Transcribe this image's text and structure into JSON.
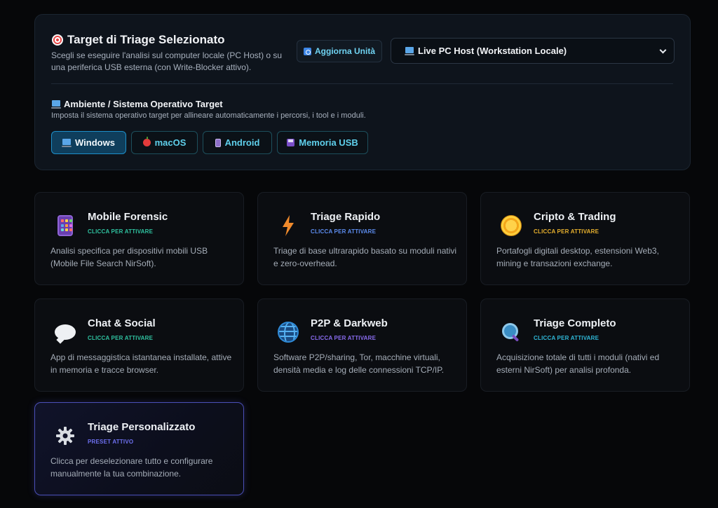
{
  "target_panel": {
    "title": "Target di Triage Selezionato",
    "description": "Scegli se eseguire l'analisi sul computer locale (PC Host) o su una periferica USB esterna (con Write-Blocker attivo).",
    "refresh_label": "Aggiorna Unità",
    "selected_target": "Live PC Host (Workstation Locale)"
  },
  "environment": {
    "title": "Ambiente / Sistema Operativo Target",
    "description": "Imposta il sistema operativo target per allineare automaticamente i percorsi, i tool e i moduli.",
    "options": [
      {
        "label": "Windows",
        "icon": "pc-icon",
        "active": true
      },
      {
        "label": "macOS",
        "icon": "apple-icon",
        "active": false
      },
      {
        "label": "Android",
        "icon": "phone-icon",
        "active": false
      },
      {
        "label": "Memoria USB",
        "icon": "floppy-disk-icon",
        "active": false
      }
    ]
  },
  "presets": [
    {
      "title": "Mobile Forensic",
      "status": "CLICCA PER ATTIVARE",
      "status_color": "#2fc2a0",
      "description": "Analisi specifica per dispositivi mobili USB (Mobile File Search NirSoft).",
      "icon": "mobile-phone-icon"
    },
    {
      "title": "Triage Rapido",
      "status": "CLICCA PER ATTIVARE",
      "status_color": "#5d8df0",
      "description": "Triage di base ultrarapido basato su moduli nativi e zero-overhead.",
      "icon": "lightning-bolt-icon"
    },
    {
      "title": "Cripto & Trading",
      "status": "CLICCA PER ATTIVARE",
      "status_color": "#e8b12e",
      "description": "Portafogli digitali desktop, estensioni Web3, mining e transazioni exchange.",
      "icon": "coin-icon"
    },
    {
      "title": "Chat & Social",
      "status": "CLICCA PER ATTIVARE",
      "status_color": "#2fc2a0",
      "description": "App di messaggistica istantanea installate, attive in memoria e tracce browser.",
      "icon": "chat-bubble-icon"
    },
    {
      "title": "P2P & Darkweb",
      "status": "CLICCA PER ATTIVARE",
      "status_color": "#8a6cf0",
      "description": "Software P2P/sharing, Tor, macchine virtuali, densità media e log delle connessioni TCP/IP.",
      "icon": "globe-icon"
    },
    {
      "title": "Triage Completo",
      "status": "CLICCA PER ATTIVARE",
      "status_color": "#2fb8d8",
      "description": "Acquisizione totale di tutti i moduli (nativi ed esterni NirSoft) per analisi profonda.",
      "icon": "magnifier-icon"
    },
    {
      "title": "Triage Personalizzato",
      "status": "PRESET ATTIVO",
      "status_color": "#6e70f0",
      "description": "Clicca per deselezionare tutto e configurare manualmente la tua combinazione.",
      "icon": "gear-icon",
      "selected": true
    }
  ]
}
